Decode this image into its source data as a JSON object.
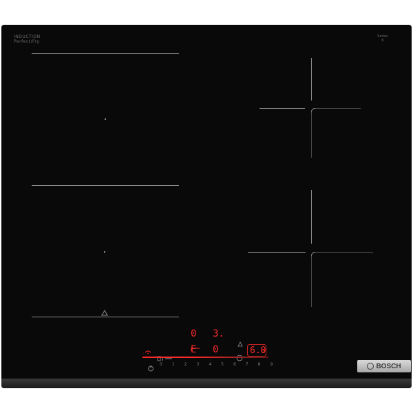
{
  "brand": {
    "name": "BOSCH",
    "logo_icon": "bosch-armature-icon"
  },
  "labels": {
    "top_left_line1": "INDUCTION",
    "top_left_line2": "Perfect/Fry",
    "top_right_line1": "Series",
    "top_right_line2": "6"
  },
  "display": {
    "zone_front_left_level": "0",
    "zone_rear_right_level": "3.",
    "zone_center_left_level": "E",
    "zone_center_right_level": "0",
    "timer_value": "6.0",
    "slider_scale": [
      "0",
      "1",
      "2",
      "3",
      "4",
      "5",
      "6",
      "7",
      "8",
      "9"
    ]
  },
  "colors": {
    "panel": "#090909",
    "display_red": "#ff2a2a",
    "guide_lines": "#8a8a8a"
  }
}
